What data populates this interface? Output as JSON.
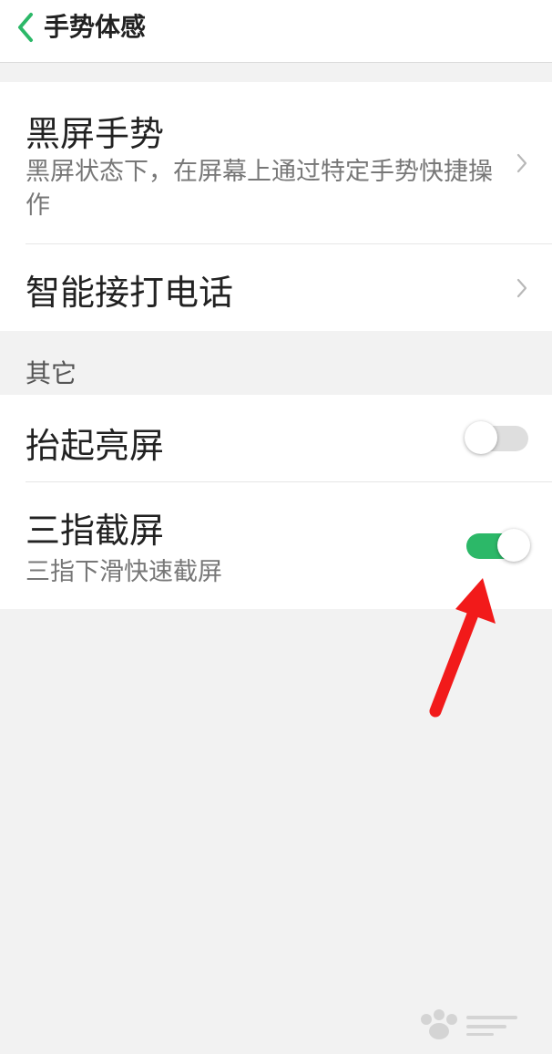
{
  "header": {
    "title": "手势体感"
  },
  "gestures": {
    "black_screen": {
      "title": "黑屏手势",
      "subtitle": "黑屏状态下，在屏幕上通过特定手势快捷操作"
    },
    "smart_call": {
      "title": "智能接打电话"
    }
  },
  "others": {
    "section_label": "其它",
    "raise_wake": {
      "title": "抬起亮屏",
      "enabled": false
    },
    "three_finger": {
      "title": "三指截屏",
      "subtitle": "三指下滑快速截屏",
      "enabled": true
    }
  },
  "colors": {
    "accent": "#2cb868",
    "toggle_off": "#dedede",
    "annotation_arrow": "#f21a1a"
  },
  "icons": {
    "back": "chevron-left-icon",
    "row_arrow": "chevron-right-icon",
    "watermark": "baidu-jingyan-logo"
  }
}
